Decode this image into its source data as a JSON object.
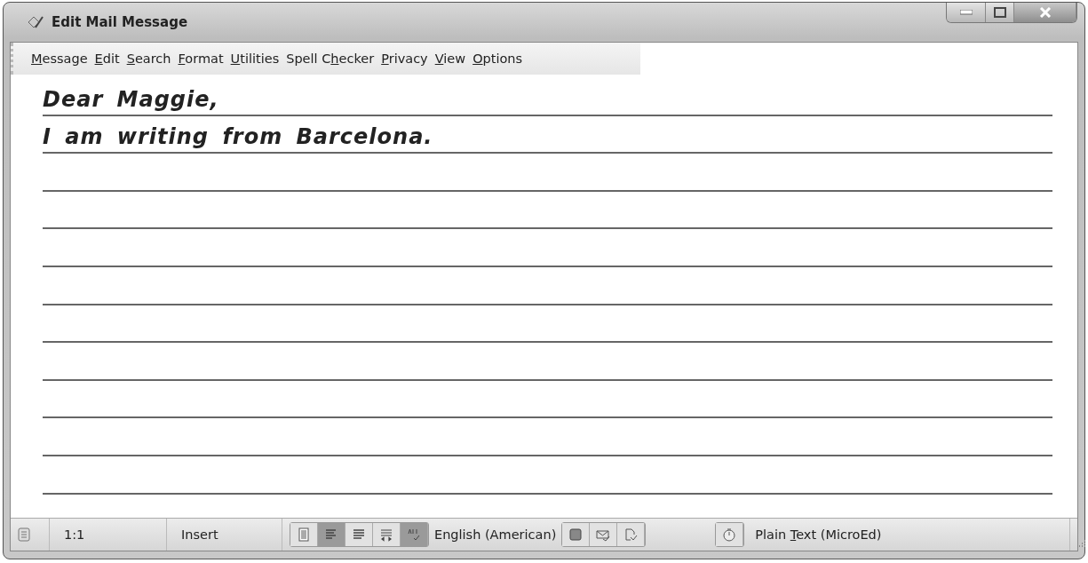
{
  "window": {
    "title": "Edit Mail Message"
  },
  "menu": [
    {
      "key": "M",
      "after": "essage"
    },
    {
      "key": "E",
      "after": "dit"
    },
    {
      "key": "S",
      "after": "earch"
    },
    {
      "key": "F",
      "after": "ormat"
    },
    {
      "key": "U",
      "after": "tilities"
    },
    {
      "before": "Spell C",
      "key": "h",
      "after": "ecker"
    },
    {
      "key": "P",
      "after": "rivacy"
    },
    {
      "key": "V",
      "after": "iew"
    },
    {
      "key": "O",
      "after": "ptions"
    }
  ],
  "message": {
    "lines": [
      "Dear Maggie,",
      "I am writing from Barcelona."
    ]
  },
  "status_bar": {
    "position": "1:1",
    "mode": "Insert",
    "format_buttons": [
      {
        "kind": "page",
        "pressed": false
      },
      {
        "kind": "left",
        "pressed": true
      },
      {
        "kind": "justify",
        "pressed": false
      },
      {
        "kind": "wrap",
        "pressed": false
      },
      {
        "kind": "spell",
        "pressed": true
      }
    ],
    "language": "English (American)",
    "tool_buttons": [
      {
        "kind": "square"
      },
      {
        "kind": "mail"
      },
      {
        "kind": "doc"
      }
    ],
    "editor": {
      "before": "Plain ",
      "key": "T",
      "after": "ext (MicroEd)"
    }
  }
}
